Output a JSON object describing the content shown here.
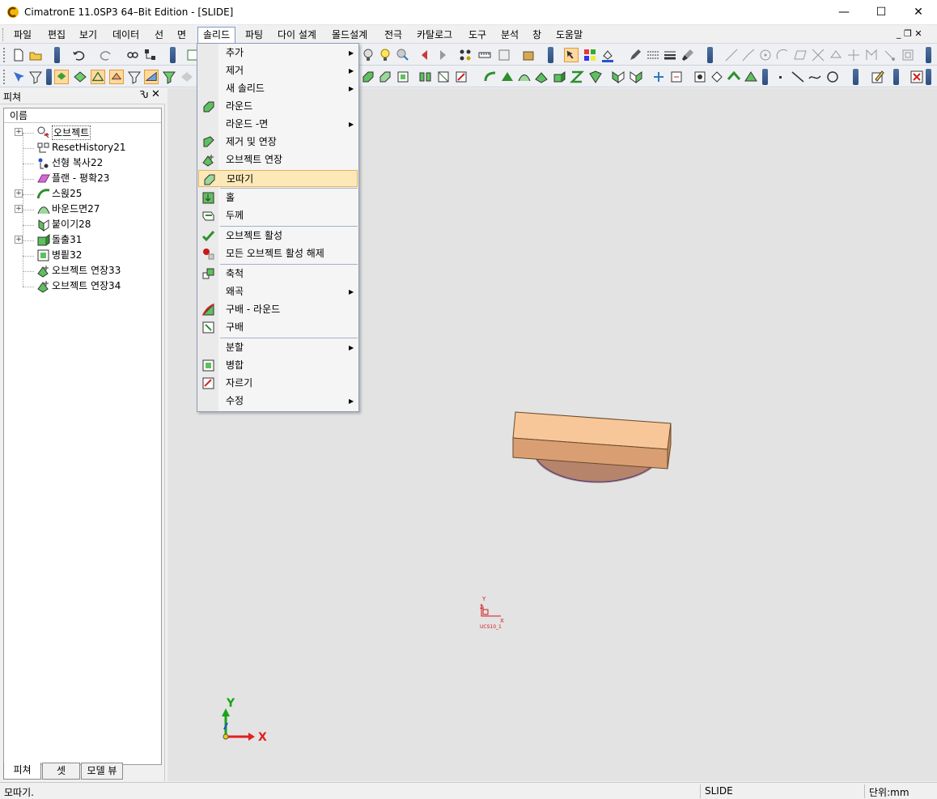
{
  "window": {
    "title": "CimatronE 11.0SP3 64–Bit Edition - [SLIDE]",
    "minimize_glyph": "—",
    "maximize_glyph": "☐",
    "close_glyph": "✕"
  },
  "menubar": {
    "items": [
      "파일",
      "편집",
      "보기",
      "데이터",
      "선",
      "면",
      "솔리드",
      "파팅",
      "다이 설계",
      "몰드설계",
      "전극",
      "카탈로그",
      "도구",
      "분석",
      "창",
      "도움말"
    ],
    "active_index": 6,
    "mdi_controls": "_ ❐ ✕"
  },
  "feature_pane": {
    "title": "피쳐",
    "pin_glyph": "Ԅ",
    "close_glyph": "✕",
    "column_header": "이름",
    "tree": [
      {
        "label": "오브젝트",
        "expandable": true,
        "selected": true,
        "icon": "objects-icon"
      },
      {
        "label": "ResetHistory21",
        "expandable": false,
        "icon": "reset-history-icon"
      },
      {
        "label": "선형 복사22",
        "expandable": false,
        "icon": "linear-copy-icon"
      },
      {
        "label": "플랜 - 평확23",
        "expandable": false,
        "icon": "plane-icon"
      },
      {
        "label": "스윉25",
        "expandable": true,
        "icon": "sweep-icon"
      },
      {
        "label": "바운드면27",
        "expandable": true,
        "icon": "bound-face-icon"
      },
      {
        "label": "붙이기28",
        "expandable": false,
        "icon": "attach-icon"
      },
      {
        "label": "돌출31",
        "expandable": true,
        "icon": "extrude-icon"
      },
      {
        "label": "병픹32",
        "expandable": false,
        "icon": "merge-icon"
      },
      {
        "label": "오브젝트 연장33",
        "expandable": false,
        "icon": "object-extend-icon"
      },
      {
        "label": "오브젝트 연장34",
        "expandable": false,
        "icon": "object-extend-icon"
      }
    ],
    "tabs": [
      "피쳐",
      "셋",
      "모델 뷰"
    ],
    "active_tab": 0
  },
  "solid_menu": {
    "items": [
      {
        "label": "추가",
        "submenu": true,
        "icon": ""
      },
      {
        "label": "제거",
        "submenu": true,
        "icon": ""
      },
      {
        "label": "새 솔리드",
        "submenu": true,
        "icon": ""
      },
      {
        "label": "라운드",
        "submenu": false,
        "icon": "round-icon"
      },
      {
        "label": "라운드 -면",
        "submenu": true,
        "icon": ""
      },
      {
        "label": "제거 및 연장",
        "submenu": false,
        "icon": "remove-extend-icon"
      },
      {
        "label": "오브젝트 연장",
        "submenu": false,
        "icon": "object-extend-icon"
      },
      {
        "label": "모따기",
        "submenu": false,
        "icon": "chamfer-icon",
        "highlighted": true
      },
      {
        "label": "홀",
        "submenu": false,
        "icon": "hole-icon"
      },
      {
        "label": "두께",
        "submenu": false,
        "icon": "thickness-icon"
      },
      {
        "label": "오브젝트 활성",
        "submenu": false,
        "icon": "activate-object-icon"
      },
      {
        "label": "모든 오브젝트 활성 해제",
        "submenu": false,
        "icon": "deactivate-all-icon"
      },
      {
        "label": "축척",
        "submenu": false,
        "icon": "scale-icon"
      },
      {
        "label": "왜곡",
        "submenu": true,
        "icon": ""
      },
      {
        "label": "구배 - 라운드",
        "submenu": false,
        "icon": "draft-round-icon"
      },
      {
        "label": "구배",
        "submenu": false,
        "icon": "draft-icon"
      },
      {
        "label": "분할",
        "submenu": true,
        "icon": ""
      },
      {
        "label": "병합",
        "submenu": false,
        "icon": "merge-icon"
      },
      {
        "label": "자르기",
        "submenu": false,
        "icon": "cut-icon"
      },
      {
        "label": "수정",
        "submenu": true,
        "icon": ""
      }
    ],
    "submenu_arrow": "▶"
  },
  "viewport": {
    "ucs_label": "UCS10_1",
    "ucs_x": "X",
    "ucs_y": "Y",
    "ucs_z": "Z",
    "axis_x": "X",
    "axis_y": "Y",
    "colors": {
      "background": "#e3e3e3",
      "part_top": "#f7c79a",
      "part_front": "#d99f72",
      "part_base": "#b5846a",
      "axis_x": "#e02020",
      "axis_y": "#19a319",
      "ucs": "#d01818"
    }
  },
  "statusbar": {
    "prompt": "모따기.",
    "file": "SLIDE",
    "units": "단위:mm"
  }
}
